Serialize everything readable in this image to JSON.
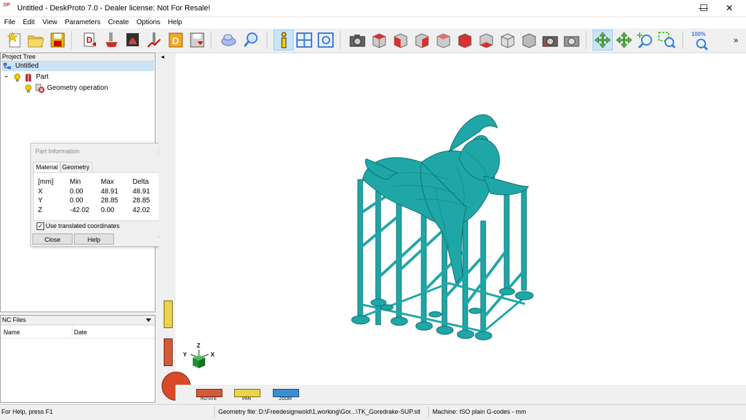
{
  "window": {
    "logo_text": "DP",
    "title": "Untitled - DeskProto 7.0 - Dealer license: Not For Resale!",
    "minimize": "—",
    "maximize": "☐",
    "close": "✕"
  },
  "menu": [
    "File",
    "Edit",
    "View",
    "Parameters",
    "Create",
    "Options",
    "Help"
  ],
  "toolbar": {
    "overflow": "»",
    "zoom_label": "100%"
  },
  "project_tree": {
    "header": "Project Tree",
    "root": "Untitled",
    "part": "Part",
    "geometry_operation": "Geometry operation",
    "expander": "⌄"
  },
  "part_info": {
    "title": "Part Information",
    "tabs": [
      "Material",
      "Geometry"
    ],
    "columns": [
      "[mm]",
      "Min",
      "Max",
      "Delta"
    ],
    "rows": [
      [
        "X",
        "0.00",
        "48.91",
        "48.91"
      ],
      [
        "Y",
        "0.00",
        "28.85",
        "28.85"
      ],
      [
        "Z",
        "-42.02",
        "0.00",
        "42.02"
      ]
    ],
    "checkbox_label": "Use translated coordinates",
    "checkbox_checked": true,
    "close_button": "Close",
    "help_button": "Help"
  },
  "nc_files": {
    "header": "NC Files",
    "columns": [
      "Name",
      "Date"
    ]
  },
  "viewport": {
    "axis_x": "X",
    "axis_y": "Y",
    "axis_z": "Z",
    "sliders": [
      "ROTATE",
      "PAN",
      "ZOOM"
    ],
    "model_color": "#1fa7a7",
    "left_arrow": "◂"
  },
  "statusbar": {
    "help": "For Help, press F1",
    "geometry_file": "Geometry file: D:\\Freedesignwold\\1.working\\Gor...\\TK_Goredrake-SUP.stl",
    "machine": "Machine: ISO plain G-codes - mm"
  }
}
